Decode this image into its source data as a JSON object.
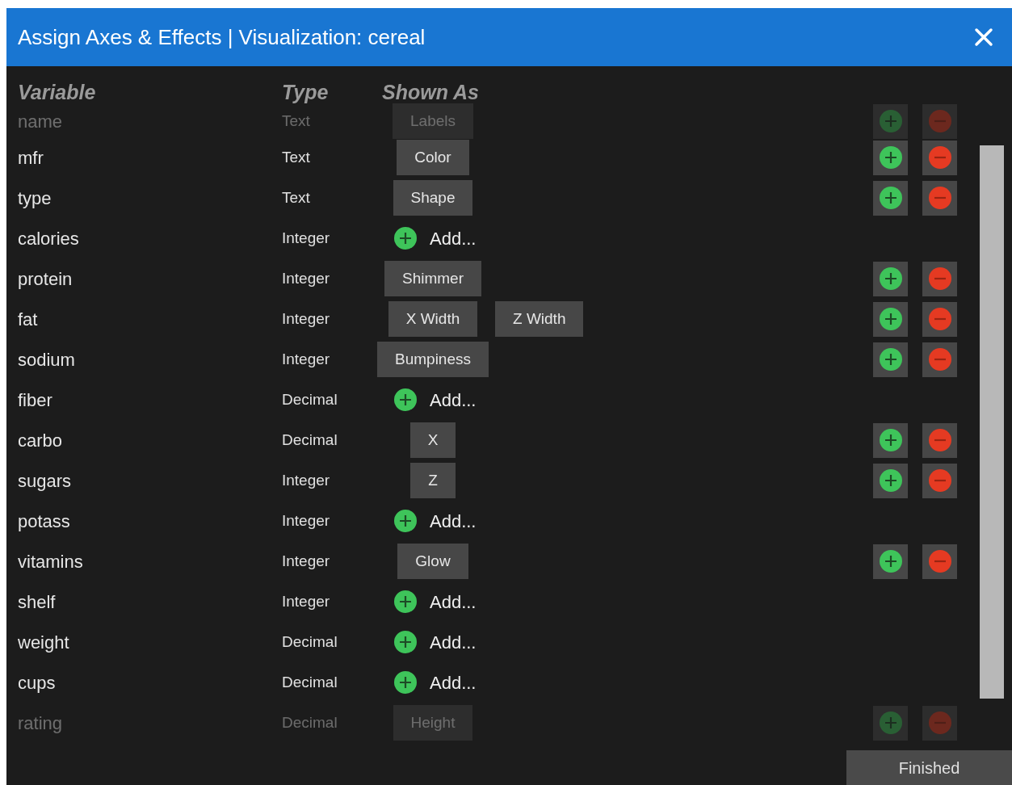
{
  "window": {
    "title": "Assign Axes & Effects | Visualization: cereal"
  },
  "columns": [
    "Variable",
    "Type",
    "Shown As"
  ],
  "rows": [
    {
      "variable": "name",
      "type": "Text",
      "faded": true,
      "kind": "assigned",
      "shown_as": [
        "Labels"
      ]
    },
    {
      "variable": "mfr",
      "type": "Text",
      "faded": false,
      "kind": "assigned",
      "shown_as": [
        "Color"
      ]
    },
    {
      "variable": "type",
      "type": "Text",
      "faded": false,
      "kind": "assigned",
      "shown_as": [
        "Shape"
      ]
    },
    {
      "variable": "calories",
      "type": "Integer",
      "faded": false,
      "kind": "add",
      "add_label": "Add..."
    },
    {
      "variable": "protein",
      "type": "Integer",
      "faded": false,
      "kind": "assigned",
      "shown_as": [
        "Shimmer"
      ]
    },
    {
      "variable": "fat",
      "type": "Integer",
      "faded": false,
      "kind": "assigned",
      "shown_as": [
        "X Width",
        "Z Width"
      ]
    },
    {
      "variable": "sodium",
      "type": "Integer",
      "faded": false,
      "kind": "assigned",
      "shown_as": [
        "Bumpiness"
      ]
    },
    {
      "variable": "fiber",
      "type": "Decimal",
      "faded": false,
      "kind": "add",
      "add_label": "Add..."
    },
    {
      "variable": "carbo",
      "type": "Decimal",
      "faded": false,
      "kind": "assigned",
      "shown_as": [
        "X"
      ]
    },
    {
      "variable": "sugars",
      "type": "Integer",
      "faded": false,
      "kind": "assigned",
      "shown_as": [
        "Z"
      ]
    },
    {
      "variable": "potass",
      "type": "Integer",
      "faded": false,
      "kind": "add",
      "add_label": "Add..."
    },
    {
      "variable": "vitamins",
      "type": "Integer",
      "faded": false,
      "kind": "assigned",
      "shown_as": [
        "Glow"
      ]
    },
    {
      "variable": "shelf",
      "type": "Integer",
      "faded": false,
      "kind": "add",
      "add_label": "Add..."
    },
    {
      "variable": "weight",
      "type": "Decimal",
      "faded": false,
      "kind": "add",
      "add_label": "Add..."
    },
    {
      "variable": "cups",
      "type": "Decimal",
      "faded": false,
      "kind": "add",
      "add_label": "Add..."
    },
    {
      "variable": "rating",
      "type": "Decimal",
      "faded": true,
      "kind": "assigned",
      "shown_as": [
        "Height"
      ]
    }
  ],
  "finished_button": "Finished"
}
